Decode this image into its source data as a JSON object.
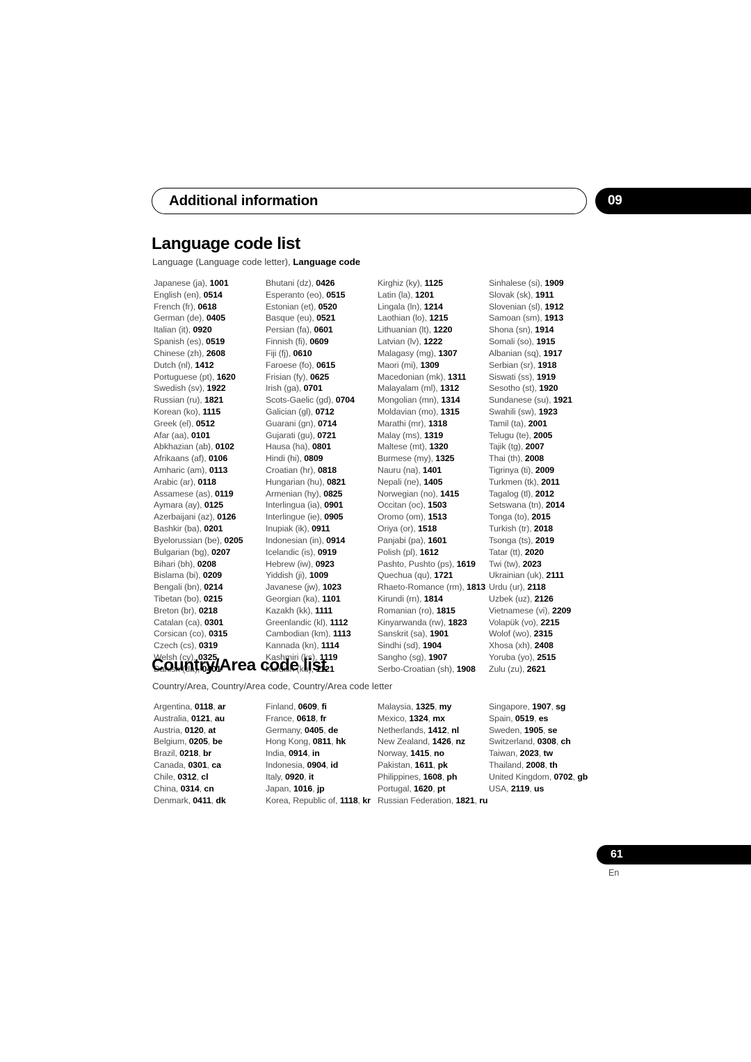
{
  "header": {
    "chapter_title": "Additional information",
    "chapter_number": "09"
  },
  "language_section": {
    "title": "Language code list",
    "subtitle_plain": "Language (Language code letter), ",
    "subtitle_bold": "Language code",
    "columns": [
      [
        {
          "name": "Japanese (ja),",
          "code": "1001"
        },
        {
          "name": "English (en),",
          "code": "0514"
        },
        {
          "name": "French (fr),",
          "code": "0618"
        },
        {
          "name": "German (de),",
          "code": "0405"
        },
        {
          "name": "Italian (it),",
          "code": "0920"
        },
        {
          "name": "Spanish (es),",
          "code": "0519"
        },
        {
          "name": "Chinese (zh),",
          "code": "2608"
        },
        {
          "name": "Dutch (nl),",
          "code": "1412"
        },
        {
          "name": "Portuguese (pt),",
          "code": "1620"
        },
        {
          "name": "Swedish (sv),",
          "code": "1922"
        },
        {
          "name": "Russian (ru),",
          "code": "1821"
        },
        {
          "name": "Korean (ko),",
          "code": "1115"
        },
        {
          "name": "Greek (el),",
          "code": "0512"
        },
        {
          "name": "Afar (aa),",
          "code": "0101"
        },
        {
          "name": "Abkhazian (ab),",
          "code": "0102"
        },
        {
          "name": "Afrikaans (af),",
          "code": "0106"
        },
        {
          "name": "Amharic (am),",
          "code": "0113"
        },
        {
          "name": "Arabic (ar),",
          "code": "0118"
        },
        {
          "name": "Assamese (as),",
          "code": "0119"
        },
        {
          "name": "Aymara (ay),",
          "code": "0125"
        },
        {
          "name": "Azerbaijani (az),",
          "code": "0126"
        },
        {
          "name": "Bashkir (ba),",
          "code": "0201"
        },
        {
          "name": "Byelorussian (be),",
          "code": "0205"
        },
        {
          "name": "Bulgarian (bg),",
          "code": "0207"
        },
        {
          "name": "Bihari (bh),",
          "code": "0208"
        },
        {
          "name": "Bislama (bi),",
          "code": "0209"
        },
        {
          "name": "Bengali (bn),",
          "code": "0214"
        },
        {
          "name": "Tibetan (bo),",
          "code": "0215"
        },
        {
          "name": "Breton (br),",
          "code": "0218"
        },
        {
          "name": "Catalan (ca),",
          "code": "0301"
        },
        {
          "name": "Corsican (co),",
          "code": "0315"
        },
        {
          "name": "Czech (cs),",
          "code": "0319"
        },
        {
          "name": "Welsh (cy),",
          "code": "0325"
        },
        {
          "name": "Danish (da),",
          "code": "0401"
        }
      ],
      [
        {
          "name": "Bhutani (dz),",
          "code": "0426"
        },
        {
          "name": "Esperanto (eo),",
          "code": "0515"
        },
        {
          "name": "Estonian (et),",
          "code": "0520"
        },
        {
          "name": "Basque (eu),",
          "code": "0521"
        },
        {
          "name": "Persian (fa),",
          "code": "0601"
        },
        {
          "name": "Finnish (fi),",
          "code": "0609"
        },
        {
          "name": "Fiji (fj),",
          "code": "0610"
        },
        {
          "name": "Faroese (fo),",
          "code": "0615"
        },
        {
          "name": "Frisian (fy),",
          "code": "0625"
        },
        {
          "name": "Irish (ga),",
          "code": "0701"
        },
        {
          "name": "Scots-Gaelic (gd),",
          "code": "0704"
        },
        {
          "name": "Galician (gl),",
          "code": "0712"
        },
        {
          "name": "Guarani (gn),",
          "code": "0714"
        },
        {
          "name": "Gujarati (gu),",
          "code": "0721"
        },
        {
          "name": "Hausa (ha),",
          "code": "0801"
        },
        {
          "name": "Hindi (hi),",
          "code": "0809"
        },
        {
          "name": "Croatian (hr),",
          "code": "0818"
        },
        {
          "name": "Hungarian (hu),",
          "code": "0821"
        },
        {
          "name": "Armenian (hy),",
          "code": "0825"
        },
        {
          "name": "Interlingua (ia),",
          "code": "0901"
        },
        {
          "name": "Interlingue (ie),",
          "code": "0905"
        },
        {
          "name": "Inupiak (ik),",
          "code": "0911"
        },
        {
          "name": "Indonesian (in),",
          "code": "0914"
        },
        {
          "name": "Icelandic (is),",
          "code": "0919"
        },
        {
          "name": "Hebrew (iw),",
          "code": "0923"
        },
        {
          "name": "Yiddish (ji),",
          "code": "1009"
        },
        {
          "name": "Javanese (jw),",
          "code": "1023"
        },
        {
          "name": "Georgian (ka),",
          "code": "1101"
        },
        {
          "name": "Kazakh (kk),",
          "code": "1111"
        },
        {
          "name": "Greenlandic  (kl),",
          "code": "1112"
        },
        {
          "name": "Cambodian (km),",
          "code": "1113"
        },
        {
          "name": "Kannada (kn),",
          "code": "1114"
        },
        {
          "name": "Kashmiri (ks),",
          "code": "1119"
        },
        {
          "name": "Kurdish (ku),",
          "code": "1121"
        }
      ],
      [
        {
          "name": "Kirghiz (ky),",
          "code": "1125"
        },
        {
          "name": "Latin (la),",
          "code": "1201"
        },
        {
          "name": "Lingala (ln),",
          "code": "1214"
        },
        {
          "name": "Laothian (lo),",
          "code": "1215"
        },
        {
          "name": "Lithuanian (lt),",
          "code": "1220"
        },
        {
          "name": "Latvian (lv),",
          "code": "1222"
        },
        {
          "name": "Malagasy (mg),",
          "code": "1307"
        },
        {
          "name": "Maori (mi),",
          "code": "1309"
        },
        {
          "name": "Macedonian (mk),",
          "code": "1311"
        },
        {
          "name": "Malayalam  (ml),",
          "code": "1312"
        },
        {
          "name": "Mongolian (mn),",
          "code": "1314"
        },
        {
          "name": "Moldavian (mo),",
          "code": "1315"
        },
        {
          "name": "Marathi (mr),",
          "code": "1318"
        },
        {
          "name": "Malay  (ms),",
          "code": "1319"
        },
        {
          "name": "Maltese (mt),",
          "code": "1320"
        },
        {
          "name": "Burmese (my),",
          "code": "1325"
        },
        {
          "name": "Nauru (na),",
          "code": "1401"
        },
        {
          "name": "Nepali (ne),",
          "code": "1405"
        },
        {
          "name": "Norwegian (no),",
          "code": "1415"
        },
        {
          "name": "Occitan (oc),",
          "code": "1503"
        },
        {
          "name": "Oromo (om),",
          "code": "1513"
        },
        {
          "name": "Oriya (or),",
          "code": "1518"
        },
        {
          "name": "Panjabi (pa),",
          "code": "1601"
        },
        {
          "name": "Polish (pl),",
          "code": "1612"
        },
        {
          "name": "Pashto, Pushto (ps),",
          "code": "1619"
        },
        {
          "name": "Quechua (qu),",
          "code": "1721"
        },
        {
          "name": "Rhaeto-Romance (rm),",
          "code": "1813"
        },
        {
          "name": "Kirundi (rn),",
          "code": "1814"
        },
        {
          "name": "Romanian (ro),",
          "code": "1815"
        },
        {
          "name": "Kinyarwanda (rw),",
          "code": "1823"
        },
        {
          "name": "Sanskrit (sa),",
          "code": "1901"
        },
        {
          "name": "Sindhi (sd),",
          "code": "1904"
        },
        {
          "name": "Sangho (sg),",
          "code": "1907"
        },
        {
          "name": "Serbo-Croatian (sh),",
          "code": "1908"
        }
      ],
      [
        {
          "name": "Sinhalese (si),",
          "code": "1909"
        },
        {
          "name": "Slovak (sk),",
          "code": "1911"
        },
        {
          "name": "Slovenian (sl),",
          "code": "1912"
        },
        {
          "name": "Samoan (sm),",
          "code": "1913"
        },
        {
          "name": "Shona (sn),",
          "code": "1914"
        },
        {
          "name": "Somali (so),",
          "code": "1915"
        },
        {
          "name": "Albanian (sq),",
          "code": "1917"
        },
        {
          "name": "Serbian (sr),",
          "code": "1918"
        },
        {
          "name": "Siswati (ss),",
          "code": "1919"
        },
        {
          "name": "Sesotho (st),",
          "code": "1920"
        },
        {
          "name": "Sundanese (su),",
          "code": "1921"
        },
        {
          "name": "Swahili (sw),",
          "code": "1923"
        },
        {
          "name": "Tamil (ta),",
          "code": "2001"
        },
        {
          "name": "Telugu (te),",
          "code": "2005"
        },
        {
          "name": "Tajik (tg),",
          "code": "2007"
        },
        {
          "name": "Thai (th),",
          "code": "2008"
        },
        {
          "name": "Tigrinya (ti),",
          "code": "2009"
        },
        {
          "name": "Turkmen (tk),",
          "code": "2011"
        },
        {
          "name": "Tagalog (tl),",
          "code": "2012"
        },
        {
          "name": "Setswana (tn),",
          "code": "2014"
        },
        {
          "name": "Tonga (to),",
          "code": "2015"
        },
        {
          "name": "Turkish (tr),",
          "code": "2018"
        },
        {
          "name": "Tsonga (ts),",
          "code": "2019"
        },
        {
          "name": "Tatar (tt),",
          "code": "2020"
        },
        {
          "name": "Twi (tw),",
          "code": "2023"
        },
        {
          "name": "Ukrainian (uk),",
          "code": "2111"
        },
        {
          "name": "Urdu (ur),",
          "code": "2118"
        },
        {
          "name": "Uzbek (uz),",
          "code": "2126"
        },
        {
          "name": "Vietnamese (vi),",
          "code": "2209"
        },
        {
          "name": "Volapük (vo),",
          "code": "2215"
        },
        {
          "name": "Wolof (wo),",
          "code": "2315"
        },
        {
          "name": "Xhosa (xh),",
          "code": "2408"
        },
        {
          "name": "Yoruba (yo),",
          "code": "2515"
        },
        {
          "name": "Zulu (zu),",
          "code": "2621"
        }
      ]
    ]
  },
  "country_section": {
    "title": "Country/Area code list",
    "subtitle": "Country/Area, Country/Area code, Country/Area code letter",
    "columns": [
      [
        {
          "name": "Argentina,",
          "code": "0118",
          "letter": "ar"
        },
        {
          "name": "Australia,",
          "code": "0121",
          "letter": "au"
        },
        {
          "name": "Austria,",
          "code": "0120",
          "letter": "at"
        },
        {
          "name": "Belgium,",
          "code": "0205",
          "letter": "be"
        },
        {
          "name": "Brazil,",
          "code": "0218",
          "letter": "br"
        },
        {
          "name": "Canada,",
          "code": "0301",
          "letter": "ca"
        },
        {
          "name": "Chile,",
          "code": "0312",
          "letter": "cl"
        },
        {
          "name": "China,",
          "code": "0314",
          "letter": "cn"
        },
        {
          "name": "Denmark,",
          "code": "0411",
          "letter": "dk"
        }
      ],
      [
        {
          "name": "Finland,",
          "code": "0609",
          "letter": "fi"
        },
        {
          "name": "France,",
          "code": "0618",
          "letter": "fr"
        },
        {
          "name": "Germany,",
          "code": "0405",
          "letter": "de"
        },
        {
          "name": "Hong Kong,",
          "code": "0811",
          "letter": "hk"
        },
        {
          "name": "India,",
          "code": "0914",
          "letter": "in"
        },
        {
          "name": "Indonesia,",
          "code": "0904",
          "letter": "id"
        },
        {
          "name": "Italy,",
          "code": "0920",
          "letter": "it"
        },
        {
          "name": "Japan,",
          "code": "1016",
          "letter": "jp"
        },
        {
          "name": "Korea, Republic of,",
          "code": "1118",
          "letter": "kr"
        }
      ],
      [
        {
          "name": "Malaysia,",
          "code": "1325",
          "letter": "my"
        },
        {
          "name": "Mexico,",
          "code": "1324",
          "letter": "mx"
        },
        {
          "name": "Netherlands,",
          "code": "1412",
          "letter": "nl"
        },
        {
          "name": "New Zealand,",
          "code": "1426",
          "letter": "nz"
        },
        {
          "name": "Norway,",
          "code": "1415",
          "letter": "no"
        },
        {
          "name": "Pakistan,",
          "code": "1611",
          "letter": "pk"
        },
        {
          "name": "Philippines,",
          "code": "1608",
          "letter": "ph"
        },
        {
          "name": "Portugal,",
          "code": "1620",
          "letter": "pt"
        },
        {
          "name": "Russian Federation,",
          "code": "1821",
          "letter": "ru"
        }
      ],
      [
        {
          "name": "Singapore,",
          "code": "1907",
          "letter": "sg"
        },
        {
          "name": "Spain,",
          "code": "0519",
          "letter": "es"
        },
        {
          "name": "Sweden,",
          "code": "1905",
          "letter": "se"
        },
        {
          "name": "Switzerland,",
          "code": "0308",
          "letter": "ch"
        },
        {
          "name": "Taiwan,",
          "code": "2023",
          "letter": "tw"
        },
        {
          "name": "Thailand,",
          "code": "2008",
          "letter": "th"
        },
        {
          "name": "United Kingdom,",
          "code": "0702",
          "letter": "gb"
        },
        {
          "name": "USA,",
          "code": "2119",
          "letter": "us"
        }
      ]
    ]
  },
  "footer": {
    "page_number": "61",
    "language_marker": "En"
  }
}
